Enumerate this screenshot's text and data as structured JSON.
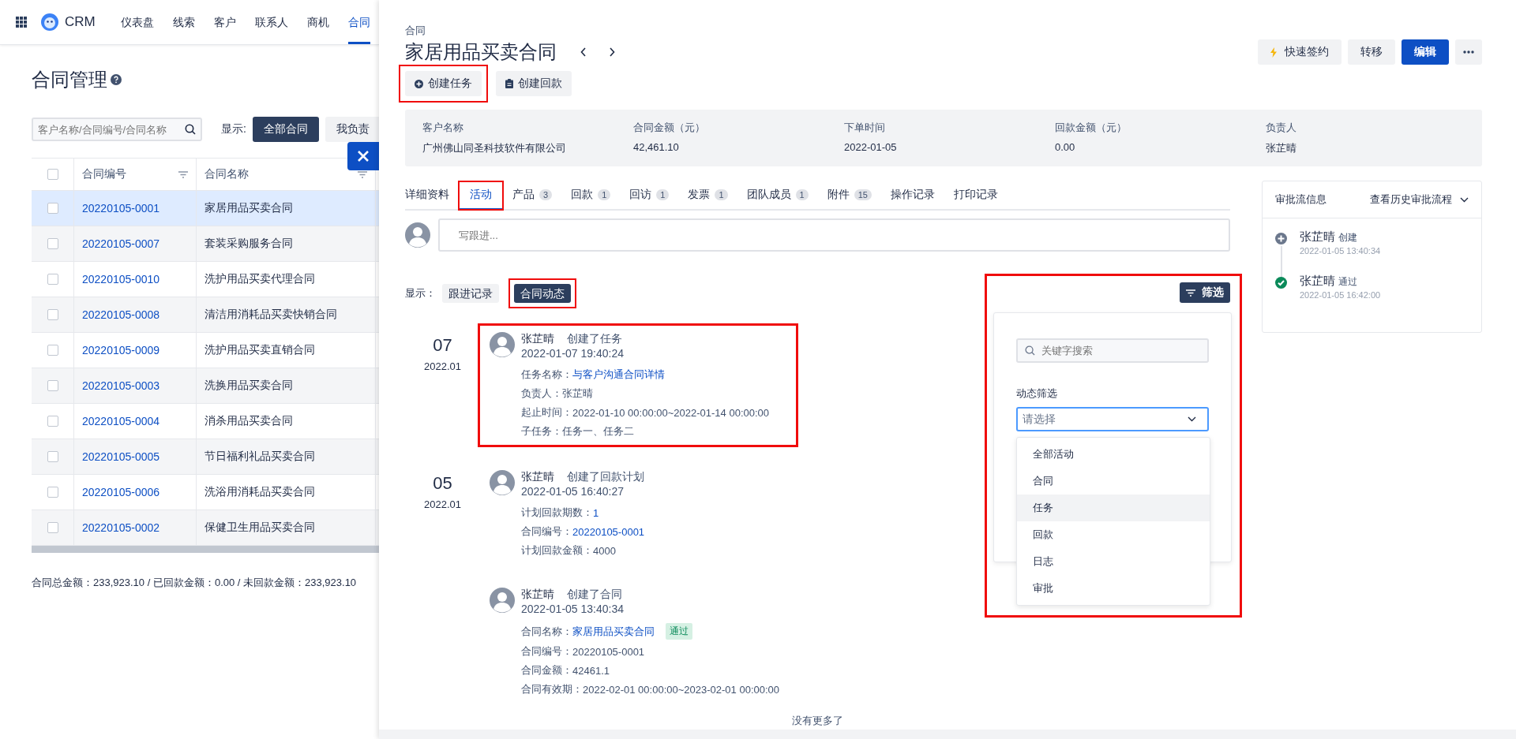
{
  "app": {
    "name": "CRM"
  },
  "nav": {
    "items": [
      {
        "label": "仪表盘",
        "selected": false
      },
      {
        "label": "线索",
        "selected": false
      },
      {
        "label": "客户",
        "selected": false
      },
      {
        "label": "联系人",
        "selected": false
      },
      {
        "label": "商机",
        "selected": false
      },
      {
        "label": "合同",
        "selected": true
      }
    ]
  },
  "list_page": {
    "title": "合同管理",
    "search": {
      "placeholder": "客户名称/合同编号/合同名称"
    },
    "display_label": "显示:",
    "views": [
      {
        "label": "全部合同",
        "selected": true
      },
      {
        "label": "我负责",
        "selected": false
      }
    ],
    "table": {
      "all_checked": false,
      "columns": [
        "合同编号",
        "合同名称"
      ],
      "rows": [
        {
          "number": "20220105-0001",
          "name": "家居用品买卖合同",
          "selected": true,
          "checked": false
        },
        {
          "number": "20220105-0007",
          "name": "套装采购服务合同",
          "selected": false,
          "checked": false
        },
        {
          "number": "20220105-0010",
          "name": "洗护用品买卖代理合同",
          "selected": false,
          "checked": false
        },
        {
          "number": "20220105-0008",
          "name": "清洁用消耗品买卖快销合同",
          "selected": false,
          "checked": false
        },
        {
          "number": "20220105-0009",
          "name": "洗护用品买卖直销合同",
          "selected": false,
          "checked": false
        },
        {
          "number": "20220105-0003",
          "name": "洗换用品买卖合同",
          "selected": false,
          "checked": false
        },
        {
          "number": "20220105-0004",
          "name": "消杀用品买卖合同",
          "selected": false,
          "checked": false
        },
        {
          "number": "20220105-0005",
          "name": "节日福利礼品买卖合同",
          "selected": false,
          "checked": false
        },
        {
          "number": "20220105-0006",
          "name": "洗浴用消耗品买卖合同",
          "selected": false,
          "checked": false
        },
        {
          "number": "20220105-0002",
          "name": "保健卫生用品买卖合同",
          "selected": false,
          "checked": false
        }
      ]
    },
    "summary": "合同总金额：233,923.10 / 已回款金额：0.00 / 未回款金额：233,923.10"
  },
  "drawer": {
    "breadcrumb": "合同",
    "title": "家居用品买卖合同",
    "actions": [
      {
        "kind": "quick",
        "label": "快速签约"
      },
      {
        "kind": "default",
        "label": "转移"
      },
      {
        "kind": "primary",
        "label": "编辑"
      },
      {
        "kind": "more"
      }
    ],
    "quick_buttons": [
      {
        "label": "创建任务",
        "highlighted": true
      },
      {
        "label": "创建回款",
        "highlighted": false
      }
    ],
    "summary_fields": [
      {
        "label": "客户名称",
        "value": "广州佛山同圣科技软件有限公司"
      },
      {
        "label": "合同金额（元）",
        "value": "42,461.10"
      },
      {
        "label": "下单时间",
        "value": "2022-01-05"
      },
      {
        "label": "回款金额（元）",
        "value": "0.00"
      },
      {
        "label": "负责人",
        "value": "张芷晴"
      }
    ],
    "tabs": [
      {
        "label": "详细资料",
        "selected": false,
        "highlighted": false
      },
      {
        "label": "活动",
        "selected": true,
        "highlighted": true
      },
      {
        "label": "产品",
        "count": "3",
        "selected": false,
        "highlighted": false
      },
      {
        "label": "回款",
        "count": "1",
        "selected": false,
        "highlighted": false
      },
      {
        "label": "回访",
        "count": "1",
        "selected": false,
        "highlighted": false
      },
      {
        "label": "发票",
        "count": "1",
        "selected": false,
        "highlighted": false
      },
      {
        "label": "团队成员",
        "count": "1",
        "selected": false,
        "highlighted": false
      },
      {
        "label": "附件",
        "count": "15",
        "selected": false,
        "highlighted": false
      },
      {
        "label": "操作记录",
        "selected": false,
        "highlighted": false
      },
      {
        "label": "打印记录",
        "selected": false,
        "highlighted": false
      }
    ],
    "comment": {
      "placeholder": "写跟进..."
    },
    "display": {
      "label": "显示：",
      "options": [
        {
          "label": "跟进记录",
          "selected": false,
          "highlighted": false
        },
        {
          "label": "合同动态",
          "selected": true,
          "highlighted": true
        }
      ]
    },
    "filter": {
      "button": "筛选",
      "highlighted": true,
      "search_placeholder": "关键字搜索",
      "field_label": "动态筛选",
      "select_placeholder": "请选择",
      "options": [
        {
          "label": "全部活动",
          "hovered": false
        },
        {
          "label": "合同",
          "hovered": false
        },
        {
          "label": "任务",
          "hovered": true
        },
        {
          "label": "回款",
          "hovered": false
        },
        {
          "label": "日志",
          "hovered": false
        },
        {
          "label": "审批",
          "hovered": false
        }
      ]
    },
    "timeline": [
      {
        "day": "07",
        "month": "2022.01",
        "entries": [
          {
            "user": "张芷晴",
            "action": "创建了任务",
            "time": "2022-01-07 19:40:24",
            "highlighted": true,
            "lines": [
              {
                "label": "任务名称：",
                "value": "与客户沟通合同详情",
                "link": true
              },
              {
                "label": "负责人：",
                "value": "张芷晴",
                "link": false
              },
              {
                "label": "起止时间：",
                "value": "2022-01-10 00:00:00~2022-01-14 00:00:00",
                "link": false
              },
              {
                "label": "子任务：",
                "value": "任务一、任务二",
                "link": false
              }
            ]
          }
        ]
      },
      {
        "day": "05",
        "month": "2022.01",
        "entries": [
          {
            "user": "张芷晴",
            "action": "创建了回款计划",
            "time": "2022-01-05 16:40:27",
            "highlighted": false,
            "lines": [
              {
                "label": "计划回款期数：",
                "value": "1",
                "link": true
              },
              {
                "label": "合同编号：",
                "value": "20220105-0001",
                "link": true
              },
              {
                "label": "计划回款金额：",
                "value": "4000",
                "link": false
              }
            ]
          },
          {
            "user": "张芷晴",
            "action": "创建了合同",
            "time": "2022-01-05 13:40:34",
            "highlighted": false,
            "lines": [
              {
                "label": "合同名称：",
                "value": "家居用品买卖合同",
                "link": true,
                "badge": "通过"
              },
              {
                "label": "合同编号：",
                "value": "20220105-0001",
                "link": false
              },
              {
                "label": "合同金额：",
                "value": "42461.1",
                "link": false
              },
              {
                "label": "合同有效期：",
                "value": "2022-02-01 00:00:00~2023-02-01 00:00:00",
                "link": false
              }
            ]
          }
        ]
      }
    ],
    "end_text": "没有更多了",
    "approval": {
      "title": "审批流信息",
      "history_link": "查看历史审批流程",
      "steps": [
        {
          "kind": "created",
          "user": "张芷晴",
          "action": "创建",
          "time": "2022-01-05 13:40:34"
        },
        {
          "kind": "approved",
          "user": "张芷晴",
          "action": "通过",
          "time": "2022-01-05 16:42:00"
        }
      ]
    }
  }
}
